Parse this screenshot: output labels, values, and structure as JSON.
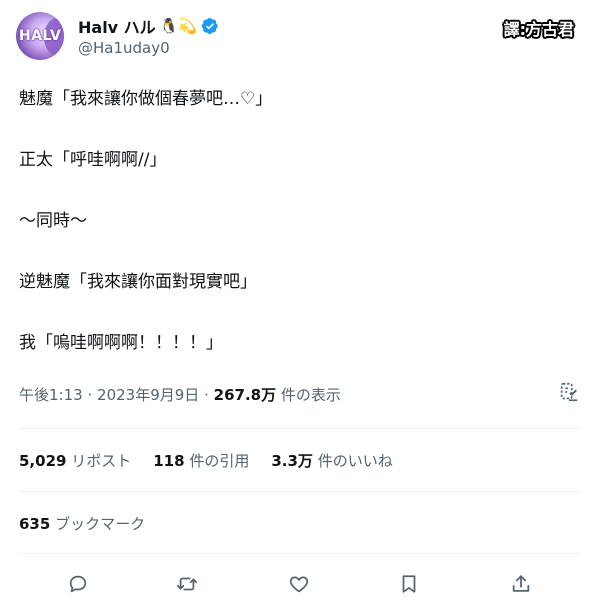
{
  "author": {
    "display_name": "Halv ハル",
    "emoji_badges": "🐧💫",
    "handle": "@Ha1uday0",
    "avatar_text": "HALV",
    "verified": true,
    "verified_color": "#1d9bf0"
  },
  "translator_tag": "譯:方古君",
  "tweet": {
    "lines": [
      "魅魔「我來讓你做個春夢吧…♡」",
      "正太「呼哇啊啊//」",
      "〜同時〜",
      "逆魅魔「我來讓你面對現實吧」",
      "我「嗚哇啊啊啊！！！！」"
    ]
  },
  "meta": {
    "time": "午後1:13",
    "separator": "·",
    "date": "2023年9月9日",
    "views_count": "267.8万",
    "views_label": "件の表示"
  },
  "stats": {
    "retweets": {
      "count": "5,029",
      "label": "リポスト"
    },
    "quotes": {
      "count": "118",
      "label": "件の引用"
    },
    "likes": {
      "count": "3.3万",
      "label": "件のいいね"
    }
  },
  "bookmarks": {
    "count": "635",
    "label": "ブックマーク"
  },
  "actions": [
    {
      "name": "reply",
      "icon": "reply-icon"
    },
    {
      "name": "repost",
      "icon": "repost-icon"
    },
    {
      "name": "like",
      "icon": "heart-icon"
    },
    {
      "name": "bookmark",
      "icon": "bookmark-icon"
    },
    {
      "name": "share",
      "icon": "share-icon"
    }
  ],
  "colors": {
    "text_primary": "#0f1419",
    "text_secondary": "#536471",
    "divider": "#eff3f4",
    "accent": "#1d9bf0"
  }
}
